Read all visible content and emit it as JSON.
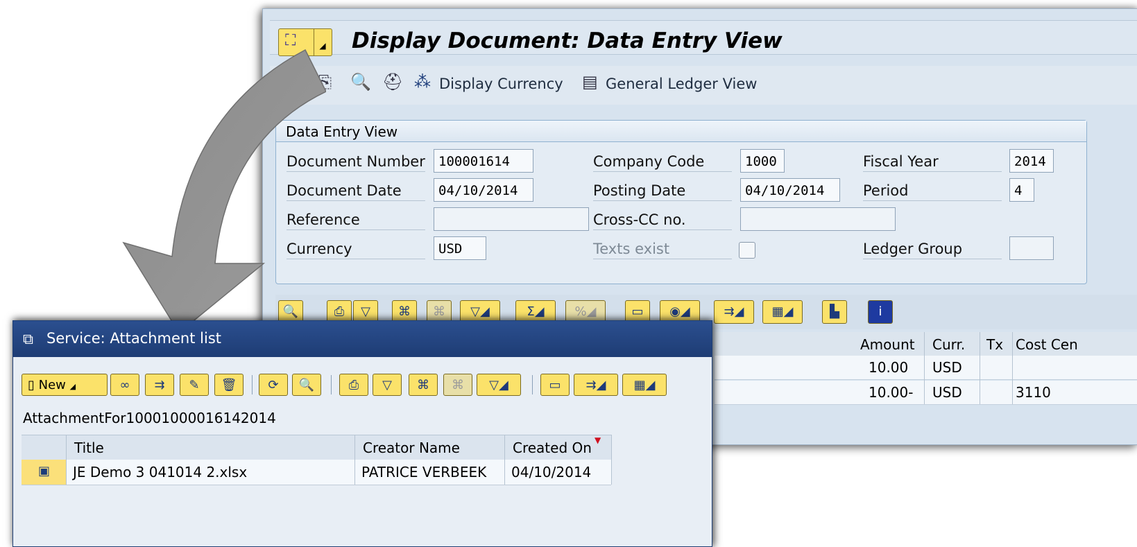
{
  "window": {
    "title": "Display Document: Data Entry View"
  },
  "app_toolbar": {
    "display_currency_label": "Display Currency",
    "general_ledger_view_label": "General Ledger View"
  },
  "data_entry": {
    "group_title": "Data Entry View",
    "document_number": {
      "label": "Document Number",
      "value": "100001614"
    },
    "company_code": {
      "label": "Company Code",
      "value": "1000"
    },
    "fiscal_year": {
      "label": "Fiscal Year",
      "value": "2014"
    },
    "document_date": {
      "label": "Document Date",
      "value": "04/10/2014"
    },
    "posting_date": {
      "label": "Posting Date",
      "value": "04/10/2014"
    },
    "period": {
      "label": "Period",
      "value": "4"
    },
    "reference": {
      "label": "Reference",
      "value": ""
    },
    "cross_cc": {
      "label": "Cross-CC no.",
      "value": ""
    },
    "currency": {
      "label": "Currency",
      "value": "USD"
    },
    "texts_exist": {
      "label": "Texts exist",
      "checked": false
    },
    "ledger_group": {
      "label": "Ledger Group",
      "value": ""
    }
  },
  "line_items": {
    "columns": [
      "Amount",
      "Curr.",
      "Tx",
      "Cost Cen"
    ],
    "rows": [
      {
        "amount": "10.00",
        "currency": "USD",
        "tax": "",
        "cost_center": ""
      },
      {
        "amount": "10.00-",
        "currency": "USD",
        "tax": "",
        "cost_center": "3110"
      }
    ]
  },
  "popup": {
    "title": "Service: Attachment list",
    "new_button_label": "New",
    "folder_name": "AttachmentFor10001000016142014",
    "columns": [
      "Title",
      "Creator Name",
      "Created On"
    ],
    "rows": [
      {
        "title": "JE Demo 3 041014 2.xlsx",
        "creator": "PATRICE VERBEEK",
        "created_on": "04/10/2014"
      }
    ]
  },
  "colors": {
    "popup_title_bar": "#1e3c74",
    "button_yellow": "#fbe26a",
    "window_background": "#d7e3ef"
  },
  "icons": [
    "menu-icon",
    "create-icon",
    "search-icon",
    "hat-icon",
    "display-currency-icon",
    "ledger-icon",
    "print-icon",
    "filter-icon",
    "find-icon",
    "sum-icon",
    "export-icon",
    "layout-icon",
    "chart-icon",
    "info-icon",
    "refresh-icon",
    "delete-icon",
    "edit-icon",
    "glasses-icon",
    "document-icon"
  ]
}
